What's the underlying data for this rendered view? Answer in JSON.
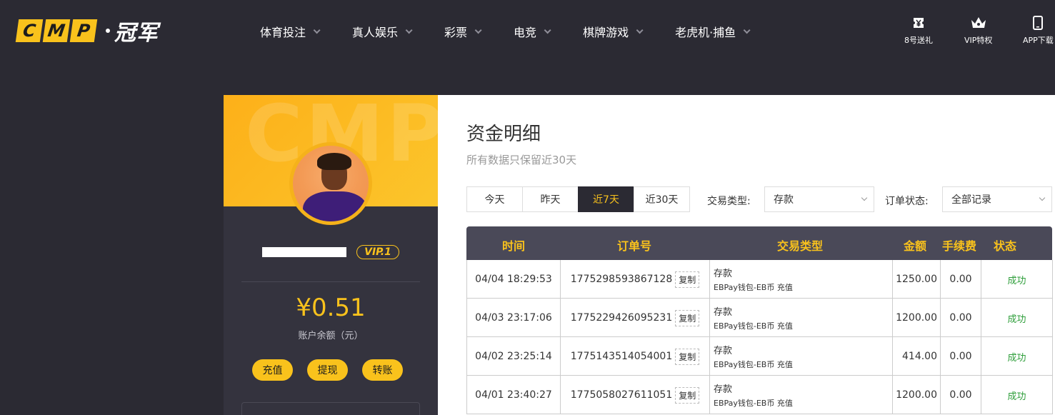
{
  "brand": {
    "letters": [
      "C",
      "M",
      "P"
    ],
    "name_cn": "冠军"
  },
  "nav": [
    {
      "label": "体育投注"
    },
    {
      "label": "真人娱乐"
    },
    {
      "label": "彩票"
    },
    {
      "label": "电竞"
    },
    {
      "label": "棋牌游戏"
    },
    {
      "label": "老虎机·捕鱼"
    }
  ],
  "top_links": [
    {
      "label": "8号送礼",
      "icon": "gift-yen-icon"
    },
    {
      "label": "VIP特权",
      "icon": "crown-icon"
    },
    {
      "label": "APP下载",
      "icon": "phone-icon"
    }
  ],
  "profile": {
    "banner_watermark": "CMP",
    "vip_label": "VIP.1",
    "balance": "¥0.51",
    "balance_label": "账户余额（元）",
    "actions": [
      {
        "label": "充值"
      },
      {
        "label": "提现"
      },
      {
        "label": "转账"
      }
    ]
  },
  "page": {
    "title": "资金明细",
    "subtitle": "所有数据只保留近30天"
  },
  "filters": {
    "tabs": [
      {
        "label": "今天",
        "active": false
      },
      {
        "label": "昨天",
        "active": false
      },
      {
        "label": "近7天",
        "active": true
      },
      {
        "label": "近30天",
        "active": false
      }
    ],
    "type_label": "交易类型:",
    "type_value": "存款",
    "status_label": "订单状态:",
    "status_value": "全部记录"
  },
  "table": {
    "headers": [
      "时间",
      "订单号",
      "交易类型",
      "金额",
      "手续费",
      "状态"
    ],
    "copy_label": "复制",
    "rows": [
      {
        "time": "04/04 18:29:53",
        "order": "1775298593867128",
        "type": "存款",
        "type_detail": "EBPay钱包-EB币 充值",
        "amount": "1250.00",
        "fee": "0.00",
        "status": "成功"
      },
      {
        "time": "04/03 23:17:06",
        "order": "1775229426095231",
        "type": "存款",
        "type_detail": "EBPay钱包-EB币 充值",
        "amount": "1200.00",
        "fee": "0.00",
        "status": "成功"
      },
      {
        "time": "04/02 23:25:14",
        "order": "1775143514054001",
        "type": "存款",
        "type_detail": "EBPay钱包-EB币 充值",
        "amount": "414.00",
        "fee": "0.00",
        "status": "成功"
      },
      {
        "time": "04/01 23:40:27",
        "order": "1775058027611051",
        "type": "存款",
        "type_detail": "EBPay钱包-EB币 充值",
        "amount": "1200.00",
        "fee": "0.00",
        "status": "成功"
      }
    ]
  },
  "colors": {
    "accent": "#f9c21c",
    "header_bg": "#2b2a33",
    "success": "#2e9e3a"
  }
}
